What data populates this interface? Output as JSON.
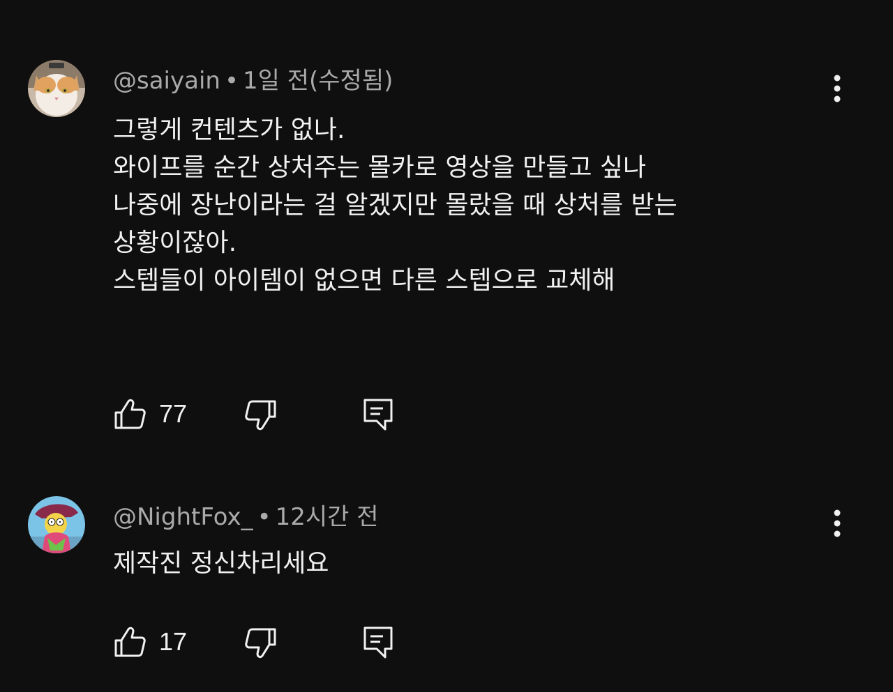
{
  "comments": [
    {
      "username": "@saiyain",
      "separator": "•",
      "time": "1일 전(수정됨)",
      "lines": [
        "그렇게 컨텐츠가 없나.",
        "와이프를 순간 상처주는 몰카로 영상을 만들고 싶나",
        "나중에 장난이라는 걸 알겠지만 몰랐을 때 상처를 받는",
        "상황이잖아.",
        "스텝들이 아이템이 없으면 다른 스텝으로 교체해"
      ],
      "likes": "77",
      "avatar_icon": "cat-avatar",
      "action_icons": [
        "thumbs-up-icon",
        "thumbs-down-icon",
        "reply-icon"
      ]
    },
    {
      "username": "@NightFox_",
      "separator": "•",
      "time": "12시간 전",
      "lines": [
        "제작진 정신차리세요"
      ],
      "likes": "17",
      "avatar_icon": "cartoon-avatar",
      "action_icons": [
        "thumbs-up-icon",
        "thumbs-down-icon",
        "reply-icon"
      ]
    }
  ],
  "colors": {
    "background": "#0f0f0f",
    "text_primary": "#f1f1f1",
    "text_secondary": "#aaaaaa"
  }
}
